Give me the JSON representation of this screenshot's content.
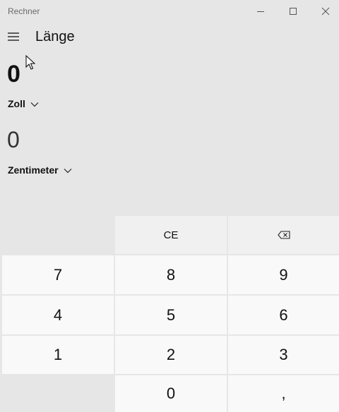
{
  "window": {
    "title": "Rechner",
    "controls": [
      "minimize-icon",
      "maximize-icon",
      "close-icon"
    ]
  },
  "header": {
    "menu_icon": "hamburger-menu-icon",
    "mode_title": "Länge"
  },
  "converter": {
    "from_value": "0",
    "from_unit": "Zoll",
    "to_value": "0",
    "to_unit": "Zentimeter"
  },
  "keypad": {
    "ce": "CE",
    "backspace_icon": "backspace-icon",
    "k7": "7",
    "k8": "8",
    "k9": "9",
    "k4": "4",
    "k5": "5",
    "k6": "6",
    "k1": "1",
    "k2": "2",
    "k3": "3",
    "k0": "0",
    "decimal": ","
  },
  "colors": {
    "background": "#e6e6e6",
    "digit_key": "#f9f9f9",
    "function_key": "#f0f0f0",
    "title_text": "#6b6b6b"
  }
}
